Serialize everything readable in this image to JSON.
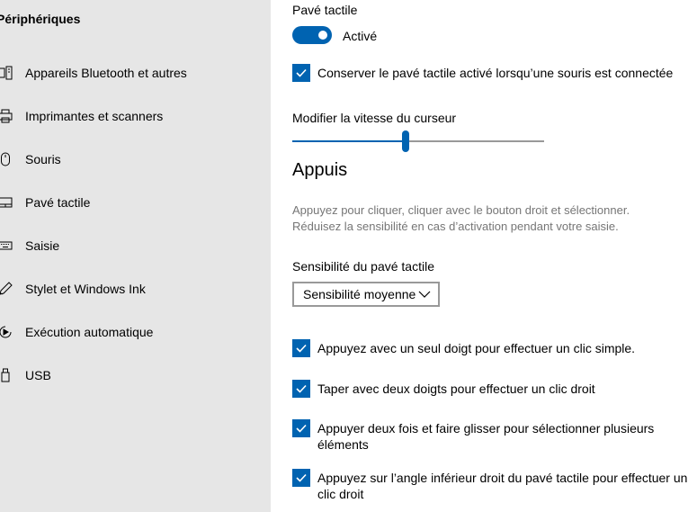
{
  "sidebar": {
    "title": "Périphériques",
    "items": [
      {
        "label": "Appareils Bluetooth et autres",
        "icon": "bluetooth-devices-icon"
      },
      {
        "label": "Imprimantes et scanners",
        "icon": "printer-icon"
      },
      {
        "label": "Souris",
        "icon": "mouse-icon"
      },
      {
        "label": "Pavé tactile",
        "icon": "touchpad-icon"
      },
      {
        "label": "Saisie",
        "icon": "keyboard-icon"
      },
      {
        "label": "Stylet et Windows Ink",
        "icon": "pen-icon"
      },
      {
        "label": "Exécution automatique",
        "icon": "autoplay-icon"
      },
      {
        "label": "USB",
        "icon": "usb-icon"
      }
    ]
  },
  "main": {
    "touchpad_label": "Pavé tactile",
    "toggle": {
      "state_label": "Activé",
      "on": true
    },
    "keep_on_with_mouse": {
      "label": "Conserver le pavé tactile activé lorsqu’une souris est connectée",
      "checked": true
    },
    "cursor_speed": {
      "label": "Modifier la vitesse du curseur",
      "value_fraction": 0.45
    },
    "taps": {
      "heading": "Appuis",
      "desc_line1": "Appuyez pour cliquer, cliquer avec le bouton droit et sélectionner.",
      "desc_line2": "Réduisez la sensibilité en cas d’activation pendant votre saisie.",
      "sensitivity_label": "Sensibilité du pavé tactile",
      "sensitivity_value": "Sensibilité moyenne",
      "options": [
        {
          "label": "Appuyez avec un seul doigt pour effectuer un clic simple.",
          "checked": true
        },
        {
          "label": "Taper avec deux doigts pour effectuer un clic droit",
          "checked": true
        },
        {
          "label_line1": "Appuyer deux fois et faire glisser pour sélectionner plusieurs",
          "label_line2": "éléments",
          "checked": true
        },
        {
          "label_line1": "Appuyez sur l’angle inférieur droit du pavé tactile pour effectuer un",
          "label_line2": "clic droit",
          "checked": true
        }
      ]
    }
  },
  "colors": {
    "accent": "#0063b1",
    "sidebar_bg": "#e6e6e6",
    "secondary_text": "#767676"
  }
}
